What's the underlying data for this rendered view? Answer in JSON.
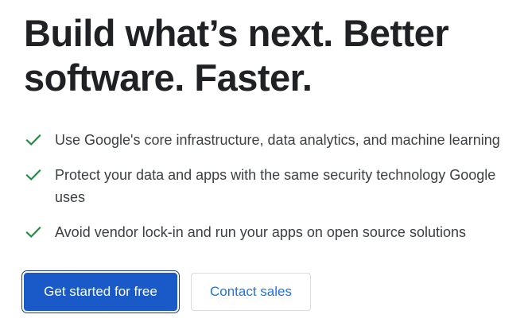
{
  "hero": {
    "headline": "Build what’s next. Better software. Faster.",
    "features": [
      {
        "icon": "check-icon",
        "text": "Use Google's core infrastructure, data analytics, and machine learning"
      },
      {
        "icon": "check-icon",
        "text": "Protect your data and apps with the same security technology Google uses"
      },
      {
        "icon": "check-icon",
        "text": "Avoid vendor lock-in and run your apps on open source solutions"
      }
    ],
    "primary_cta": "Get started for free",
    "secondary_cta": "Contact sales"
  },
  "colors": {
    "check_green": "#1e8e3e",
    "primary_blue": "#1a5ac8",
    "link_blue": "#1a73e8",
    "heading_text": "#202124",
    "body_text": "#3c4043"
  }
}
